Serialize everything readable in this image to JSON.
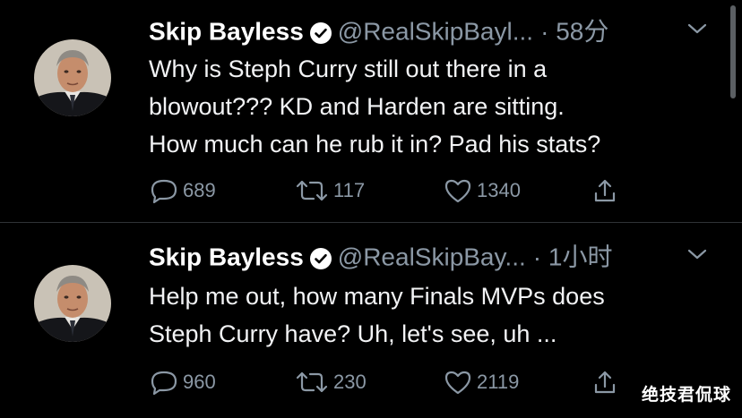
{
  "tweets": [
    {
      "name": "Skip Bayless",
      "handle": "@RealSkipBayl...",
      "separator": "·",
      "time": "58分",
      "lines": [
        "Why is Steph Curry still out there in a",
        "blowout??? KD and Harden are sitting.",
        "How much can he rub it in? Pad his stats?"
      ],
      "replies": "689",
      "retweets": "117",
      "likes": "1340"
    },
    {
      "name": "Skip Bayless",
      "handle": "@RealSkipBay...",
      "separator": "·",
      "time": "1小时",
      "lines": [
        "Help me out, how many Finals MVPs does",
        "Steph Curry have? Uh, let's see, uh ..."
      ],
      "replies": "960",
      "retweets": "230",
      "likes": "2119"
    }
  ],
  "watermark": "绝技君侃球",
  "icons": {
    "verified": "verified-badge-icon",
    "menu": "chevron-down-icon",
    "reply": "reply-icon",
    "retweet": "retweet-icon",
    "like": "heart-icon",
    "share": "share-icon"
  },
  "colors": {
    "background": "#000000",
    "text": "#f2f3f5",
    "muted": "#8b98a5",
    "divider": "#2f3336"
  }
}
